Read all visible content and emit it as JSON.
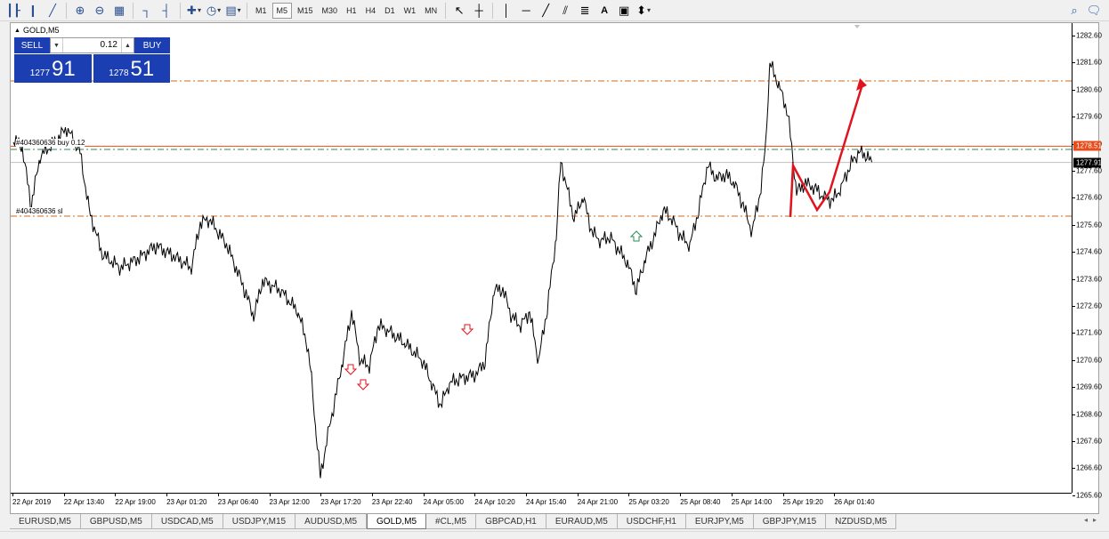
{
  "toolbar": {
    "left_icons": [
      "bar-chart-icon",
      "candlestick-icon",
      "line-chart-icon",
      "zoom-in-icon",
      "zoom-out-icon",
      "tile-windows-icon",
      "chart-shift-icon",
      "auto-scroll-icon",
      "indicators-icon",
      "periods-icon",
      "templates-icon"
    ],
    "timeframes": [
      "M1",
      "M5",
      "M15",
      "M30",
      "H1",
      "H4",
      "D1",
      "W1",
      "MN"
    ],
    "active_timeframe": "M5",
    "draw_icons": [
      "cursor-icon",
      "crosshair-icon",
      "vertical-line-icon",
      "horizontal-line-icon",
      "trendline-icon",
      "equidistant-channel-icon",
      "fibonacci-icon",
      "text-icon",
      "text-label-icon",
      "arrows-icon"
    ],
    "right_icons": [
      "search-icon",
      "chat-icon"
    ]
  },
  "chart": {
    "symbol_label": "GOLD,M5",
    "price_axis": [
      "1282.60",
      "1281.60",
      "1280.60",
      "1279.60",
      "1278.60",
      "1277.60",
      "1276.60",
      "1275.60",
      "1274.60",
      "1273.60",
      "1272.60",
      "1271.60",
      "1270.60",
      "1269.60",
      "1268.60",
      "1267.60",
      "1266.60",
      "1265.60"
    ],
    "ask_tag": "1278.51",
    "bid_tag": "1277.91",
    "time_axis": [
      "22 Apr 2019",
      "22 Apr 13:40",
      "22 Apr 19:00",
      "23 Apr 01:20",
      "23 Apr 06:40",
      "23 Apr 12:00",
      "23 Apr 17:20",
      "23 Apr 22:40",
      "24 Apr 05:00",
      "24 Apr 10:20",
      "24 Apr 15:40",
      "24 Apr 21:00",
      "25 Apr 03:20",
      "25 Apr 08:40",
      "25 Apr 14:00",
      "25 Apr 19:20",
      "26 Apr 01:40"
    ],
    "order_label_tp": "#404360636 buy 0.12",
    "order_label_sl": "#404360636 sl",
    "colors": {
      "ask_line": "#e84c1a",
      "bid_line": "#c0c0c0",
      "level_line": "#d2691e",
      "entry_line": "#2e8b57",
      "annotation": "#e0141e",
      "price_bars": "#000000"
    }
  },
  "oneclick": {
    "sell_label": "SELL",
    "buy_label": "BUY",
    "lot": "0.12",
    "sell_small": "1277",
    "sell_big": "91",
    "buy_small": "1278",
    "buy_big": "51"
  },
  "tabs": [
    "EURUSD,M5",
    "GBPUSD,M5",
    "USDCAD,M5",
    "USDJPY,M15",
    "AUDUSD,M5",
    "GOLD,M5",
    "#CL,M5",
    "GBPCAD,H1",
    "EURAUD,M5",
    "USDCHF,H1",
    "EURJPY,M5",
    "GBPJPY,M15",
    "NZDUSD,M5"
  ],
  "active_tab": "GOLD,M5",
  "tab_scroll": [
    "◂",
    "▸"
  ]
}
